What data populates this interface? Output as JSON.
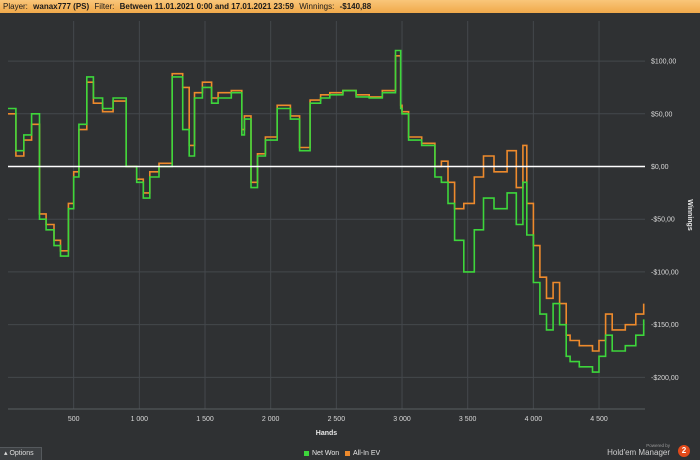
{
  "header": {
    "player_label": "Player:",
    "player_value": "wanax777 (PS)",
    "filter_label": "Filter:",
    "filter_value": "Between 11.01.2021 0:00 and 17.01.2021 23:59",
    "winnings_label": "Winnings:",
    "winnings_value": "-$140,88"
  },
  "options_label": "Options",
  "legend": {
    "net_won": "Net Won",
    "allin_ev": "All-In EV"
  },
  "brand": {
    "powered": "Powered by",
    "name": "Hold'em Manager",
    "badge": "2"
  },
  "colors": {
    "net_won": "#3dd63b",
    "allin_ev": "#ee8a2c",
    "background": "#2f3133",
    "zero_line": "#ffffff",
    "header": "#f4b25a"
  },
  "chart_data": {
    "type": "line",
    "xlabel": "Hands",
    "ylabel": "Winnings",
    "xlim": [
      0,
      4850
    ],
    "ylim": [
      -230,
      138
    ],
    "grid": true,
    "legend_position": "bottom-center",
    "x_ticks": [
      500,
      1000,
      1500,
      2000,
      2500,
      3000,
      3500,
      4000,
      4500
    ],
    "x_tick_labels": [
      "500",
      "1 000",
      "1 500",
      "2 000",
      "2 500",
      "3 000",
      "3 500",
      "4 000",
      "4 500"
    ],
    "y_ticks": [
      100,
      50,
      0,
      -50,
      -100,
      -150,
      -200
    ],
    "y_tick_labels": [
      "$100,00",
      "$50,00",
      "$0,00",
      "-$50,00",
      "-$100,00",
      "-$150,00",
      "-$200,00"
    ],
    "x": [
      0,
      60,
      120,
      180,
      240,
      290,
      350,
      400,
      460,
      500,
      540,
      600,
      650,
      720,
      800,
      900,
      980,
      1030,
      1080,
      1150,
      1250,
      1330,
      1380,
      1420,
      1480,
      1550,
      1600,
      1700,
      1780,
      1800,
      1850,
      1900,
      1960,
      2050,
      2150,
      2220,
      2300,
      2380,
      2450,
      2550,
      2650,
      2750,
      2850,
      2950,
      2990,
      3000,
      3050,
      3150,
      3250,
      3300,
      3350,
      3400,
      3470,
      3550,
      3620,
      3700,
      3800,
      3870,
      3920,
      3950,
      4000,
      4050,
      4100,
      4150,
      4200,
      4250,
      4280,
      4350,
      4450,
      4500,
      4550,
      4600,
      4700,
      4780,
      4840
    ],
    "series": [
      {
        "name": "Net Won",
        "values": [
          55,
          15,
          30,
          50,
          -50,
          -60,
          -75,
          -85,
          -40,
          -10,
          40,
          85,
          65,
          55,
          65,
          0,
          -15,
          -30,
          -10,
          0,
          85,
          35,
          10,
          65,
          75,
          60,
          65,
          70,
          30,
          45,
          -20,
          10,
          25,
          55,
          45,
          15,
          60,
          65,
          68,
          72,
          66,
          65,
          70,
          110,
          55,
          50,
          25,
          20,
          -10,
          -15,
          -35,
          -70,
          -100,
          -60,
          -30,
          -40,
          -25,
          -55,
          -15,
          -65,
          -110,
          -140,
          -155,
          -130,
          -150,
          -180,
          -185,
          -190,
          -195,
          -180,
          -160,
          -175,
          -170,
          -160,
          -145
        ]
      },
      {
        "name": "All-In EV",
        "values": [
          50,
          10,
          25,
          40,
          -45,
          -55,
          -70,
          -80,
          -35,
          -5,
          35,
          80,
          60,
          52,
          62,
          0,
          -12,
          -25,
          -5,
          3,
          88,
          75,
          20,
          70,
          80,
          65,
          70,
          72,
          35,
          48,
          -15,
          12,
          28,
          58,
          48,
          18,
          63,
          68,
          70,
          72,
          68,
          66,
          72,
          105,
          58,
          52,
          28,
          22,
          0,
          5,
          -15,
          -40,
          -35,
          -10,
          10,
          -5,
          15,
          -20,
          20,
          -35,
          -75,
          -105,
          -125,
          -110,
          -130,
          -160,
          -165,
          -170,
          -175,
          -165,
          -140,
          -155,
          -150,
          -140,
          -130
        ]
      }
    ]
  }
}
